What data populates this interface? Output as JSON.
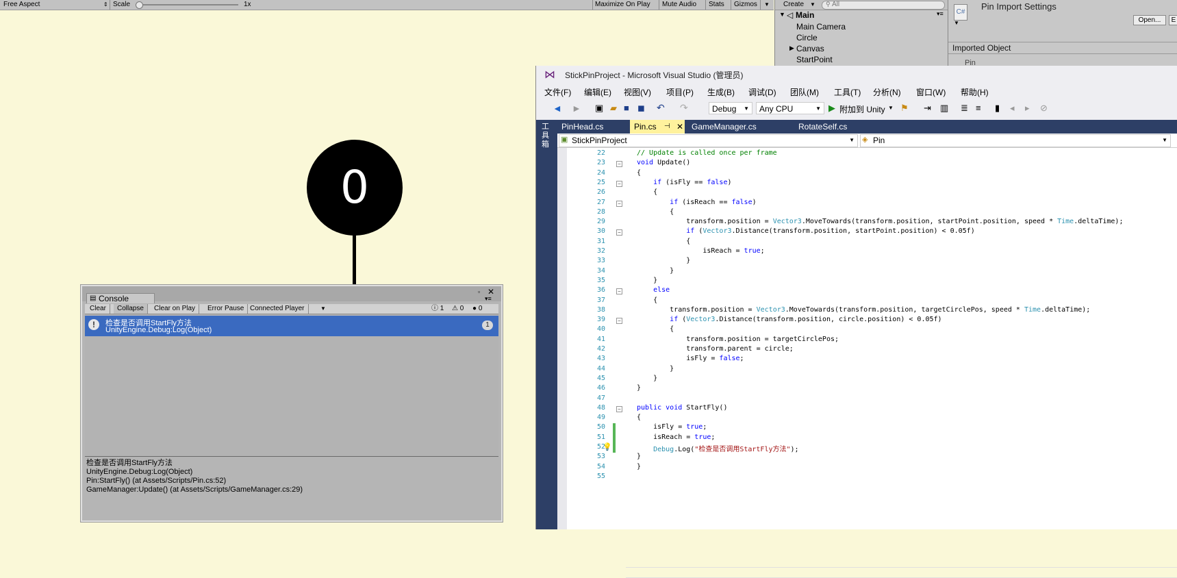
{
  "game_toolbar": {
    "aspect": "Free Aspect",
    "scale_label": "Scale",
    "scale_value": "1x",
    "maximize_on_play": "Maximize On Play",
    "mute_audio": "Mute Audio",
    "stats": "Stats",
    "gizmos": "Gizmos"
  },
  "game_view": {
    "circle_text": "0"
  },
  "hierarchy": {
    "create_label": "Create",
    "search_placeholder": "All",
    "scene_name": "Main",
    "items": [
      "Main Camera",
      "Circle",
      "Canvas",
      "StartPoint"
    ]
  },
  "inspector": {
    "title": "Pin Import Settings",
    "open_button": "Open...",
    "edit_button": "E",
    "section": "Imported Object",
    "object_name": "Pin"
  },
  "console": {
    "tab_label": "Console",
    "toolbar": {
      "clear": "Clear",
      "collapse": "Collapse",
      "clear_on_play": "Clear on Play",
      "error_pause": "Error Pause",
      "connected_player": "Connected Player",
      "info_count": "1",
      "warn_count": "0",
      "error_count": "0"
    },
    "entry": {
      "line1": "检查是否调用StartFly方法",
      "line2": "UnityEngine.Debug:Log(Object)",
      "count": "1"
    },
    "detail": [
      "检查是否调用StartFly方法",
      "UnityEngine.Debug:Log(Object)",
      "Pin:StartFly() (at Assets/Scripts/Pin.cs:52)",
      "GameManager:Update() (at Assets/Scripts/GameManager.cs:29)"
    ]
  },
  "vs": {
    "title": "StickPinProject - Microsoft Visual Studio (管理员)",
    "menu": [
      "文件(F)",
      "编辑(E)",
      "视图(V)",
      "项目(P)",
      "生成(B)",
      "调试(D)",
      "团队(M)",
      "工具(T)",
      "分析(N)",
      "窗口(W)",
      "帮助(H)"
    ],
    "config": "Debug",
    "platform": "Any CPU",
    "attach_label": "附加到 Unity",
    "sidebar_label": "工具箱",
    "tabs": [
      "PinHead.cs",
      "Pin.cs",
      "GameManager.cs",
      "RotateSelf.cs"
    ],
    "active_tab": "Pin.cs",
    "nav_project": "StickPinProject",
    "nav_class": "Pin",
    "code_lines": [
      {
        "n": "22",
        "t": "// Update is called once per frame"
      },
      {
        "n": "23",
        "t": "void Update()"
      },
      {
        "n": "24",
        "t": "{"
      },
      {
        "n": "25",
        "t": "    if (isFly == false)"
      },
      {
        "n": "26",
        "t": "    {"
      },
      {
        "n": "27",
        "t": "        if (isReach == false)"
      },
      {
        "n": "28",
        "t": "        {"
      },
      {
        "n": "29",
        "t": "            transform.position = Vector3.MoveTowards(transform.position, startPoint.position, speed * Time.deltaTime);"
      },
      {
        "n": "30",
        "t": "            if (Vector3.Distance(transform.position, startPoint.position) < 0.05f)"
      },
      {
        "n": "31",
        "t": "            {"
      },
      {
        "n": "32",
        "t": "                isReach = true;"
      },
      {
        "n": "33",
        "t": "            }"
      },
      {
        "n": "34",
        "t": "        }"
      },
      {
        "n": "35",
        "t": "    }"
      },
      {
        "n": "36",
        "t": "    else"
      },
      {
        "n": "37",
        "t": "    {"
      },
      {
        "n": "38",
        "t": "        transform.position = Vector3.MoveTowards(transform.position, targetCirclePos, speed * Time.deltaTime);"
      },
      {
        "n": "39",
        "t": "        if (Vector3.Distance(transform.position, circle.position) < 0.05f)"
      },
      {
        "n": "40",
        "t": "        {"
      },
      {
        "n": "41",
        "t": "            transform.position = targetCirclePos;"
      },
      {
        "n": "42",
        "t": "            transform.parent = circle;"
      },
      {
        "n": "43",
        "t": "            isFly = false;"
      },
      {
        "n": "44",
        "t": "        }"
      },
      {
        "n": "45",
        "t": "    }"
      },
      {
        "n": "46",
        "t": "}"
      },
      {
        "n": "47",
        "t": ""
      },
      {
        "n": "48",
        "t": "public void StartFly()"
      },
      {
        "n": "49",
        "t": "{"
      },
      {
        "n": "50",
        "t": "    isFly = true;"
      },
      {
        "n": "51",
        "t": "    isReach = true;"
      },
      {
        "n": "52",
        "t": "    Debug.Log(\"检查是否调用StartFly方法\");"
      },
      {
        "n": "53",
        "t": "}"
      },
      {
        "n": "54",
        "t": "}"
      },
      {
        "n": "55",
        "t": ""
      }
    ]
  }
}
